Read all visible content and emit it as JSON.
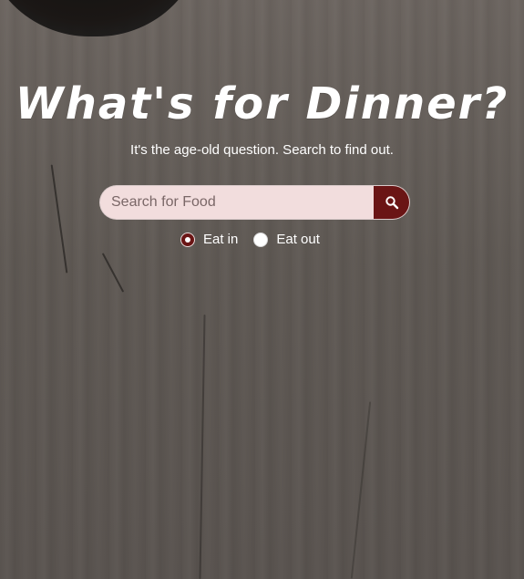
{
  "hero": {
    "title": "What's for Dinner?",
    "subtitle": "It's the age-old question. Search to find out."
  },
  "search": {
    "placeholder": "Search for Food",
    "value": "",
    "button_icon": "search-icon"
  },
  "options": {
    "items": [
      {
        "label": "Eat in",
        "selected": true
      },
      {
        "label": "Eat out",
        "selected": false
      }
    ]
  },
  "colors": {
    "background": "#5e5853",
    "accent": "#6a1515",
    "input_background": "#f2dddd",
    "text": "#ffffff"
  }
}
